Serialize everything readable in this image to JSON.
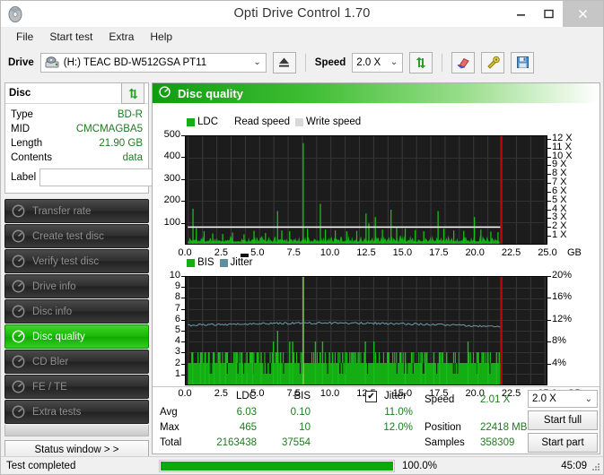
{
  "window": {
    "title": "Opti Drive Control 1.70",
    "icon": "disc-icon",
    "minimize": "–",
    "maximize": "❐",
    "close": "✕"
  },
  "menu": {
    "items": [
      "File",
      "Start test",
      "Extra",
      "Help"
    ]
  },
  "toolbar": {
    "drive_label": "Drive",
    "drive_value": "(H:)   TEAC BD-W512GSA PT11",
    "speed_label": "Speed",
    "speed_value": "2.0 X",
    "refresh_icon": "refresh-arrows-icon",
    "erase_icon": "eraser-icon",
    "tools_icon": "tools-icon",
    "save_icon": "floppy-save-icon"
  },
  "disc": {
    "header": "Disc",
    "refresh_icon": "refresh-arrows-icon",
    "rows": [
      {
        "key": "Type",
        "value": "BD-R"
      },
      {
        "key": "MID",
        "value": "CMCMAGBA5"
      },
      {
        "key": "Length",
        "value": "21.90 GB"
      },
      {
        "key": "Contents",
        "value": "data"
      }
    ],
    "label_key": "Label",
    "label_value": "",
    "label_placeholder": "",
    "disc_button_icon": "cd-disc-icon"
  },
  "nav": {
    "items": [
      {
        "label": "Transfer rate",
        "active": false
      },
      {
        "label": "Create test disc",
        "active": false
      },
      {
        "label": "Verify test disc",
        "active": false
      },
      {
        "label": "Drive info",
        "active": false
      },
      {
        "label": "Disc info",
        "active": false
      },
      {
        "label": "Disc quality",
        "active": true
      },
      {
        "label": "CD Bler",
        "active": false
      },
      {
        "label": "FE / TE",
        "active": false
      },
      {
        "label": "Extra tests",
        "active": false
      }
    ],
    "status_window": "Status window > >"
  },
  "panel": {
    "title": "Disc quality",
    "icon": "disc-quality-icon"
  },
  "chart_data": [
    {
      "type": "bar",
      "name": "ldc-chart",
      "title": "",
      "legend": [
        {
          "label": "LDC",
          "color": "#14ad14"
        },
        {
          "label": "Read speed",
          "color": "#ffffff"
        },
        {
          "label": "Write speed",
          "color": "#d8d8d8"
        }
      ],
      "xlabel": "GB",
      "ylabel": "",
      "xticks": [
        "0.0",
        "2.5",
        "5.0",
        "7.5",
        "10.0",
        "12.5",
        "15.0",
        "17.5",
        "20.0",
        "22.5",
        "25.0"
      ],
      "xlim": [
        0,
        25
      ],
      "yticks_left": [
        "100",
        "200",
        "300",
        "400",
        "500"
      ],
      "ylim_left": [
        0,
        500
      ],
      "yticks_right": [
        "1 X",
        "2 X",
        "3 X",
        "4 X",
        "5 X",
        "6 X",
        "7 X",
        "8 X",
        "9 X",
        "10 X",
        "11 X",
        "12 X"
      ],
      "ylim_right": [
        0,
        12.4
      ],
      "grid": true,
      "end_marker_gb": 21.9,
      "end_marker_color": "#e00000",
      "read_speed_line": 2.0,
      "baseline_noise_max": 40,
      "peaks": [
        {
          "x": 0.32,
          "y": 163
        },
        {
          "x": 0.55,
          "y": 72
        },
        {
          "x": 1.1,
          "y": 58
        },
        {
          "x": 1.7,
          "y": 48
        },
        {
          "x": 2.4,
          "y": 46
        },
        {
          "x": 3.1,
          "y": 52
        },
        {
          "x": 3.9,
          "y": 44
        },
        {
          "x": 4.6,
          "y": 60
        },
        {
          "x": 5.4,
          "y": 50
        },
        {
          "x": 6.25,
          "y": 152
        },
        {
          "x": 6.55,
          "y": 62
        },
        {
          "x": 7.1,
          "y": 58
        },
        {
          "x": 8.05,
          "y": 468
        },
        {
          "x": 8.35,
          "y": 70
        },
        {
          "x": 9.25,
          "y": 186
        },
        {
          "x": 9.6,
          "y": 66
        },
        {
          "x": 10.3,
          "y": 62
        },
        {
          "x": 11.1,
          "y": 58
        },
        {
          "x": 11.8,
          "y": 60
        },
        {
          "x": 12.45,
          "y": 141
        },
        {
          "x": 12.65,
          "y": 95
        },
        {
          "x": 13.1,
          "y": 124
        },
        {
          "x": 13.6,
          "y": 66
        },
        {
          "x": 14.2,
          "y": 158
        },
        {
          "x": 14.6,
          "y": 80
        },
        {
          "x": 15.2,
          "y": 70
        },
        {
          "x": 15.9,
          "y": 64
        },
        {
          "x": 16.5,
          "y": 58
        },
        {
          "x": 17.5,
          "y": 152
        },
        {
          "x": 17.9,
          "y": 70
        },
        {
          "x": 18.6,
          "y": 62
        },
        {
          "x": 19.3,
          "y": 60
        },
        {
          "x": 20.05,
          "y": 124
        },
        {
          "x": 20.5,
          "y": 66
        },
        {
          "x": 21.2,
          "y": 56
        },
        {
          "x": 21.7,
          "y": 54
        }
      ]
    },
    {
      "type": "bar",
      "name": "bis-jitter-chart",
      "title": "",
      "legend": [
        {
          "label": "BIS",
          "color": "#14ad14"
        },
        {
          "label": "Jitter",
          "color": "#5f8f9a"
        }
      ],
      "xlabel": "GB",
      "xticks": [
        "0.0",
        "2.5",
        "5.0",
        "7.5",
        "10.0",
        "12.5",
        "15.0",
        "17.5",
        "20.0",
        "22.5",
        "25.0"
      ],
      "xlim": [
        0,
        25
      ],
      "yticks_left": [
        "1",
        "2",
        "3",
        "4",
        "5",
        "6",
        "7",
        "8",
        "9",
        "10"
      ],
      "ylim_left": [
        0,
        10
      ],
      "yticks_right": [
        "4%",
        "8%",
        "12%",
        "16%",
        "20%"
      ],
      "ylim_right": [
        0,
        20
      ],
      "grid": true,
      "end_marker_gb": 21.9,
      "end_marker_color": "#e00000",
      "bis_fill_level": 2,
      "jitter_series_avg_pct": 11.0,
      "jitter_series_max_pct": 12.0,
      "peaks": [
        {
          "x": 0.3,
          "y": 3
        },
        {
          "x": 0.85,
          "y": 3
        },
        {
          "x": 1.15,
          "y": 3
        },
        {
          "x": 1.45,
          "y": 3
        },
        {
          "x": 1.8,
          "y": 3
        },
        {
          "x": 2.2,
          "y": 3
        },
        {
          "x": 2.6,
          "y": 3
        },
        {
          "x": 3.35,
          "y": 3
        },
        {
          "x": 3.75,
          "y": 3
        },
        {
          "x": 4.1,
          "y": 3
        },
        {
          "x": 4.5,
          "y": 3
        },
        {
          "x": 5.1,
          "y": 3
        },
        {
          "x": 5.95,
          "y": 4
        },
        {
          "x": 6.25,
          "y": 5
        },
        {
          "x": 6.45,
          "y": 3
        },
        {
          "x": 7.1,
          "y": 4
        },
        {
          "x": 7.3,
          "y": 4
        },
        {
          "x": 8.05,
          "y": 10
        },
        {
          "x": 8.9,
          "y": 4
        },
        {
          "x": 9.4,
          "y": 4
        },
        {
          "x": 10.1,
          "y": 3
        },
        {
          "x": 10.5,
          "y": 3
        },
        {
          "x": 11.0,
          "y": 3
        },
        {
          "x": 12.4,
          "y": 4
        },
        {
          "x": 13.0,
          "y": 4
        },
        {
          "x": 14.0,
          "y": 3
        },
        {
          "x": 15.2,
          "y": 3
        },
        {
          "x": 16.3,
          "y": 3
        },
        {
          "x": 16.6,
          "y": 3
        },
        {
          "x": 17.2,
          "y": 3
        },
        {
          "x": 17.6,
          "y": 3
        },
        {
          "x": 18.1,
          "y": 3
        },
        {
          "x": 19.6,
          "y": 4
        },
        {
          "x": 20.3,
          "y": 3
        },
        {
          "x": 21.0,
          "y": 3
        },
        {
          "x": 21.6,
          "y": 3
        }
      ]
    }
  ],
  "stats": {
    "col_ldc": "LDC",
    "col_bis": "BIS",
    "row_avg": "Avg",
    "row_max": "Max",
    "row_total": "Total",
    "ldc_avg": "6.03",
    "ldc_max": "465",
    "ldc_total": "2163438",
    "bis_avg": "0.10",
    "bis_max": "10",
    "bis_total": "37554",
    "jitter_label": "Jitter",
    "jitter_checked": true,
    "jitter_check_glyph": "✔",
    "jitter_avg": "11.0%",
    "jitter_max": "12.0%",
    "speed_label": "Speed",
    "speed_value": "2.01 X",
    "position_label": "Position",
    "position_value": "22418 MB",
    "samples_label": "Samples",
    "samples_value": "358309",
    "speed_select": "2.0 X",
    "start_full": "Start full",
    "start_part": "Start part"
  },
  "statusbar": {
    "message": "Test completed",
    "progress_pct": 100.0,
    "progress_text": "100.0%",
    "elapsed": "45:09"
  },
  "colors": {
    "green": "#14ad14",
    "dark_green_text": "#1f7a1f",
    "plot_bg": "#1c1c1c",
    "marker_red": "#e00000",
    "jitter": "#5f8f9a",
    "accent": "#17b703"
  }
}
